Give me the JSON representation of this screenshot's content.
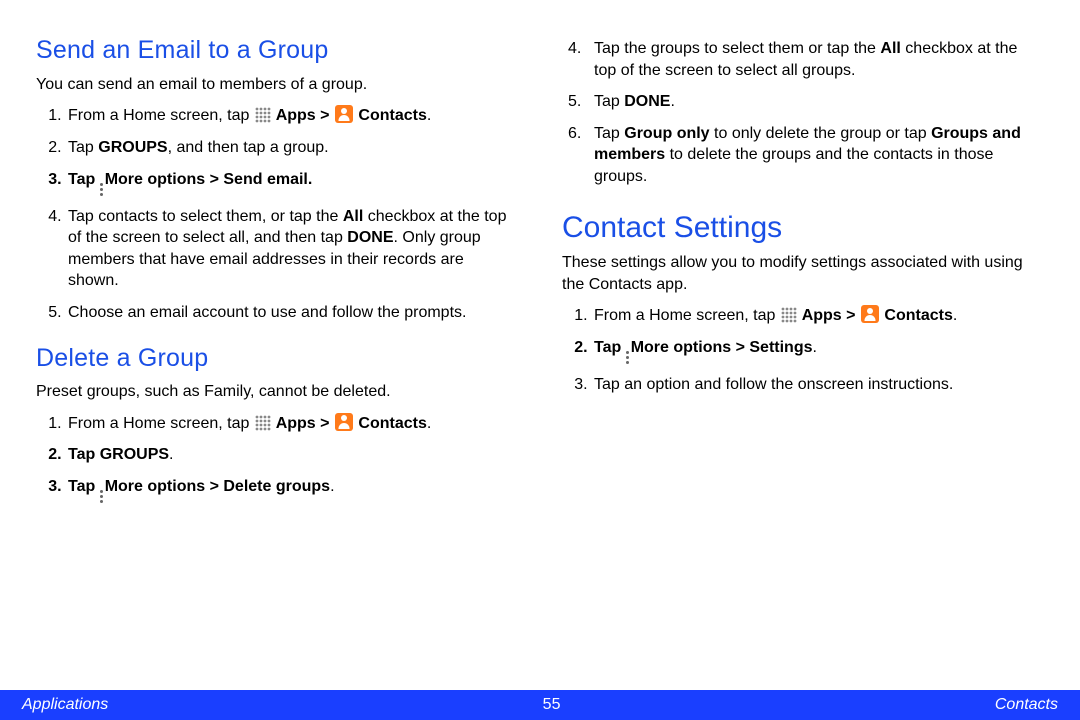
{
  "left": {
    "section1_title": "Send an Email to a Group",
    "section1_intro": "You can send an email to members of a group.",
    "s1_step1_pre": "From a Home screen, tap ",
    "s1_step1_apps": " Apps > ",
    "s1_step1_contacts": " Contacts",
    "s1_step2_a": "Tap ",
    "s1_step2_b": "GROUPS",
    "s1_step2_c": ", and then tap a group.",
    "s1_step3_a": "Tap ",
    "s1_step3_b": "More options > Send email",
    "s1_step3_c": ".",
    "s1_step4_a": "Tap contacts to select them, or tap the ",
    "s1_step4_b": "All",
    "s1_step4_c": " checkbox at the top of the screen to select all, and then tap ",
    "s1_step4_d": "DONE",
    "s1_step4_e": ". Only group members that have email addresses in their records are shown.",
    "s1_step5": "Choose an email account to use and follow the prompts.",
    "section2_title": "Delete a Group",
    "section2_intro": "Preset groups, such as Family, cannot be deleted.",
    "s2_step1_pre": "From a Home screen, tap ",
    "s2_step1_apps": " Apps > ",
    "s2_step1_contacts": " Contacts",
    "s2_step2_a": "Tap ",
    "s2_step2_b": "GROUPS",
    "s2_step2_c": ".",
    "s2_step3_a": "Tap ",
    "s2_step3_b": "More options > Delete groups",
    "s2_step3_c": "."
  },
  "right": {
    "cont_step4_a": "Tap the groups to select them or tap the ",
    "cont_step4_b": "All",
    "cont_step4_c": " checkbox at the top of the screen to select all groups.",
    "cont_step5_a": "Tap ",
    "cont_step5_b": "DONE",
    "cont_step5_c": ".",
    "cont_step6_a": "Tap ",
    "cont_step6_b": "Group only",
    "cont_step6_c": " to only delete the group or tap ",
    "cont_step6_d": "Groups and members",
    "cont_step6_e": " to delete the groups and the contacts in those groups.",
    "section3_title": "Contact Settings",
    "section3_intro": "These settings allow you to modify settings associated with using the Contacts app.",
    "s3_step1_pre": "From a Home screen, tap ",
    "s3_step1_apps": " Apps > ",
    "s3_step1_contacts": " Contacts",
    "s3_step2_a": "Tap ",
    "s3_step2_b": "More options > Settings",
    "s3_step2_c": ".",
    "s3_step3": "Tap an option and follow the onscreen instructions."
  },
  "footer": {
    "left": "Applications",
    "page": "55",
    "right": "Contacts"
  }
}
